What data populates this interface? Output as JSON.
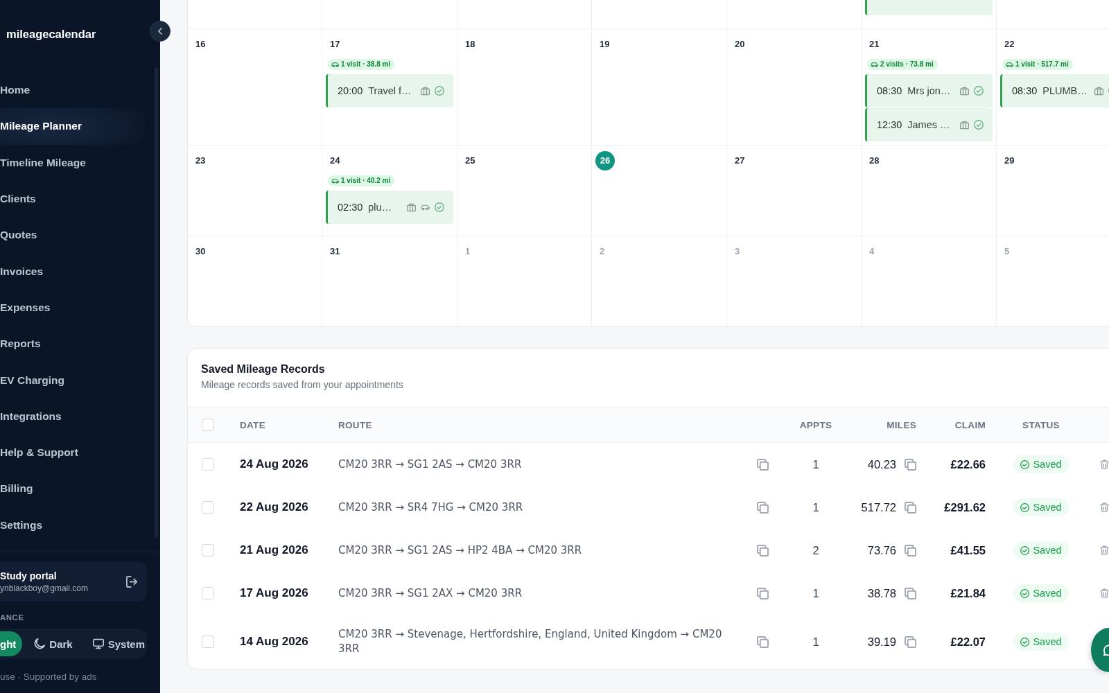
{
  "sidebar": {
    "logo": "mileagecalendar",
    "nav_items": [
      {
        "label": "Home",
        "selected": false
      },
      {
        "label": "Mileage Planner",
        "selected": true
      },
      {
        "label": "Timeline Mileage",
        "selected": false
      },
      {
        "label": "Clients",
        "selected": false
      },
      {
        "label": "Quotes",
        "selected": false
      },
      {
        "label": "Invoices",
        "selected": false
      },
      {
        "label": "Expenses",
        "selected": false
      },
      {
        "label": "Reports",
        "selected": false
      },
      {
        "label": "EV Charging",
        "selected": false
      },
      {
        "label": "Integrations",
        "selected": false
      },
      {
        "label": "Help & Support",
        "selected": false
      },
      {
        "label": "Billing",
        "selected": false
      },
      {
        "label": "Settings",
        "selected": false
      }
    ],
    "account": {
      "name": "Study portal",
      "email": "ynblackboy@gmail.com"
    },
    "appearance": {
      "label": "ANCE",
      "options": [
        {
          "kind": "light",
          "label": "ght",
          "selected": true
        },
        {
          "kind": "dark",
          "label": "Dark",
          "selected": false
        },
        {
          "kind": "system",
          "label": "System",
          "selected": false
        }
      ]
    },
    "footer": "use · Supported by ads"
  },
  "calendar": {
    "weeks": [
      {
        "partial": true,
        "days": [
          {
            "event": false
          },
          {
            "event": false
          },
          {
            "event": false
          },
          {
            "event": false
          },
          {
            "event": false
          },
          {
            "event": true
          },
          {
            "event": false
          }
        ]
      },
      {
        "partial": false,
        "days": [
          {
            "number": "16",
            "muted": false,
            "today": false
          },
          {
            "number": "17",
            "muted": false,
            "today": false,
            "visits": "1 visit · 38.8 mi",
            "events": [
              {
                "time": "20:00",
                "title": "Travel f…",
                "car": false
              }
            ]
          },
          {
            "number": "18",
            "muted": false,
            "today": false
          },
          {
            "number": "19",
            "muted": false,
            "today": false
          },
          {
            "number": "20",
            "muted": false,
            "today": false
          },
          {
            "number": "21",
            "muted": false,
            "today": false,
            "visits": "2 visits · 73.8 mi",
            "events": [
              {
                "time": "08:30",
                "title": "Mrs jon…",
                "car": false
              },
              {
                "time": "12:30",
                "title": "James …",
                "car": false
              }
            ]
          },
          {
            "number": "22",
            "muted": false,
            "today": false,
            "visits": "1 visit · 517.7 mi",
            "events": [
              {
                "time": "08:30",
                "title": "PLUMB…",
                "car": false
              }
            ]
          }
        ]
      },
      {
        "partial": false,
        "days": [
          {
            "number": "23",
            "muted": false,
            "today": false
          },
          {
            "number": "24",
            "muted": false,
            "today": false,
            "visits": "1 visit · 40.2 mi",
            "events": [
              {
                "time": "02:30",
                "title": "plu…",
                "car": true
              }
            ]
          },
          {
            "number": "25",
            "muted": false,
            "today": false
          },
          {
            "number": "26",
            "muted": false,
            "today": true
          },
          {
            "number": "27",
            "muted": false,
            "today": false
          },
          {
            "number": "28",
            "muted": false,
            "today": false
          },
          {
            "number": "29",
            "muted": false,
            "today": false
          }
        ]
      },
      {
        "partial": false,
        "days": [
          {
            "number": "30",
            "muted": false,
            "today": false
          },
          {
            "number": "31",
            "muted": false,
            "today": false
          },
          {
            "number": "1",
            "muted": true,
            "today": false
          },
          {
            "number": "2",
            "muted": true,
            "today": false
          },
          {
            "number": "3",
            "muted": true,
            "today": false
          },
          {
            "number": "4",
            "muted": true,
            "today": false
          },
          {
            "number": "5",
            "muted": true,
            "today": false
          }
        ]
      }
    ]
  },
  "records": {
    "title": "Saved Mileage Records",
    "subtitle": "Mileage records saved from your appointments",
    "select_all_checked": false,
    "columns": [
      "DATE",
      "ROUTE",
      "APPTS",
      "MILES",
      "CLAIM",
      "STATUS"
    ],
    "rows": [
      {
        "checked": false,
        "date": "24 Aug 2026",
        "route": "CM20 3RR → SG1 2AS → CM20 3RR",
        "appts": "1",
        "miles": "40.23",
        "claim": "£22.66",
        "status": "Saved",
        "trash": true
      },
      {
        "checked": false,
        "date": "22 Aug 2026",
        "route": "CM20 3RR → SR4 7HG → CM20 3RR",
        "appts": "1",
        "miles": "517.72",
        "claim": "£291.62",
        "status": "Saved",
        "trash": true
      },
      {
        "checked": false,
        "date": "21 Aug 2026",
        "route": "CM20 3RR → SG1 2AS → HP2 4BA → CM20 3RR",
        "appts": "2",
        "miles": "73.76",
        "claim": "£41.55",
        "status": "Saved",
        "trash": true
      },
      {
        "checked": false,
        "date": "17 Aug 2026",
        "route": "CM20 3RR → SG1 2AX → CM20 3RR",
        "appts": "1",
        "miles": "38.78",
        "claim": "£21.84",
        "status": "Saved",
        "trash": true
      },
      {
        "checked": false,
        "date": "14 Aug 2026",
        "route": "CM20 3RR → Stevenage, Hertfordshire, England, United Kingdom → CM20 3RR",
        "appts": "1",
        "miles": "39.19",
        "claim": "£22.07",
        "status": "Saved",
        "trash": false
      }
    ]
  }
}
